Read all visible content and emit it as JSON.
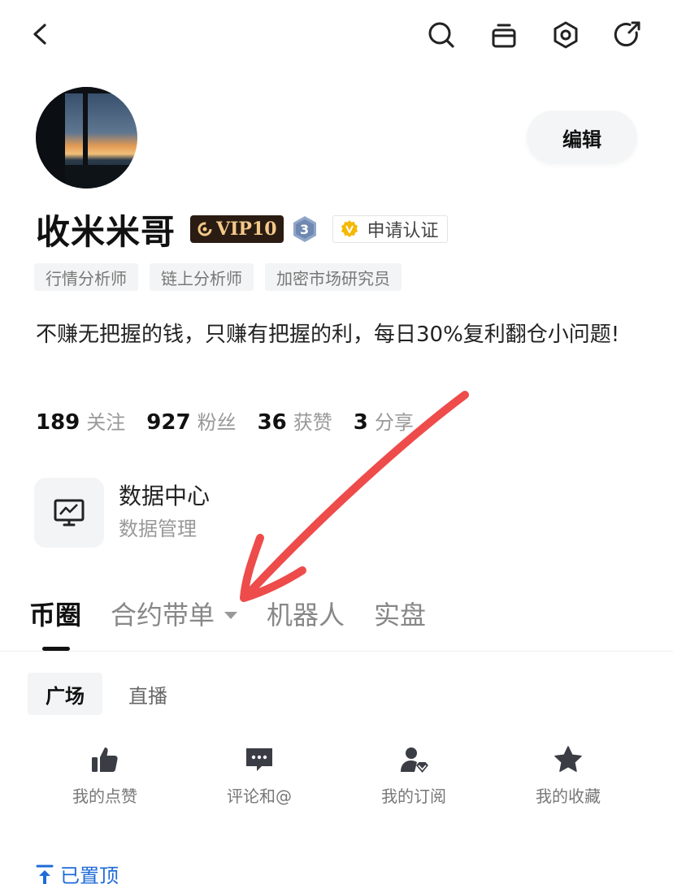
{
  "profile": {
    "username": "收米米哥",
    "vip_label": "VIP10",
    "level": "3",
    "verify_label": "申请认证",
    "edit_label": "编辑",
    "tags": [
      "行情分析师",
      "链上分析师",
      "加密市场研究员"
    ],
    "bio": "不赚无把握的钱，只赚有把握的利，每日30%复利翻仓小问题!"
  },
  "stats": [
    {
      "num": "189",
      "label": "关注"
    },
    {
      "num": "927",
      "label": "粉丝"
    },
    {
      "num": "36",
      "label": "获赞"
    },
    {
      "num": "3",
      "label": "分享"
    }
  ],
  "data_center": {
    "title": "数据中心",
    "subtitle": "数据管理"
  },
  "main_tabs": [
    "币圈",
    "合约带单",
    "机器人",
    "实盘"
  ],
  "sub_tabs": [
    "广场",
    "直播"
  ],
  "actions": [
    {
      "label": "我的点赞",
      "icon": "thumbs-up-icon"
    },
    {
      "label": "评论和@",
      "icon": "comment-icon"
    },
    {
      "label": "我的订阅",
      "icon": "subscription-icon"
    },
    {
      "label": "我的收藏",
      "icon": "star-icon"
    }
  ],
  "pinned_label": "已置顶",
  "colors": {
    "accent_blue": "#1e6bd6",
    "vip_gold": "#f3c98a",
    "vip_bg": "#2a1c12",
    "arrow_red": "#ee4b4b"
  },
  "icons": {
    "back": "back-arrow-icon",
    "search": "search-icon",
    "gift": "gift-icon",
    "settings": "settings-hexagon-icon",
    "share": "share-icon"
  }
}
